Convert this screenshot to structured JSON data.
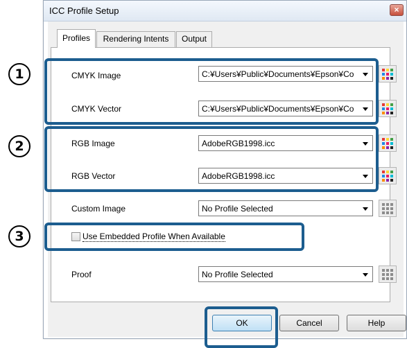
{
  "window": {
    "title": "ICC Profile Setup",
    "close_glyph": "×"
  },
  "tabs": [
    {
      "label": "Profiles",
      "active": true
    },
    {
      "label": "Rendering Intents",
      "active": false
    },
    {
      "label": "Output",
      "active": false
    }
  ],
  "rows": {
    "cmyk_image": {
      "label": "CMYK Image",
      "value": "C:¥Users¥Public¥Documents¥Epson¥Co"
    },
    "cmyk_vector": {
      "label": "CMYK Vector",
      "value": "C:¥Users¥Public¥Documents¥Epson¥Co"
    },
    "rgb_image": {
      "label": "RGB Image",
      "value": "AdobeRGB1998.icc"
    },
    "rgb_vector": {
      "label": "RGB Vector",
      "value": "AdobeRGB1998.icc"
    },
    "custom_image": {
      "label": "Custom Image",
      "value": "No Profile Selected"
    },
    "proof": {
      "label": "Proof",
      "value": "No Profile Selected"
    }
  },
  "embedded": {
    "label": "Use Embedded Profile When Available",
    "checked": false
  },
  "buttons": {
    "ok": "OK",
    "cancel": "Cancel",
    "help": "Help"
  },
  "markers": {
    "one": "1",
    "two": "2",
    "three": "3"
  },
  "colors": {
    "highlight": "#1c5d8f",
    "title_bar": "#dfe8f3",
    "ok_button": "#bfe0f5"
  }
}
